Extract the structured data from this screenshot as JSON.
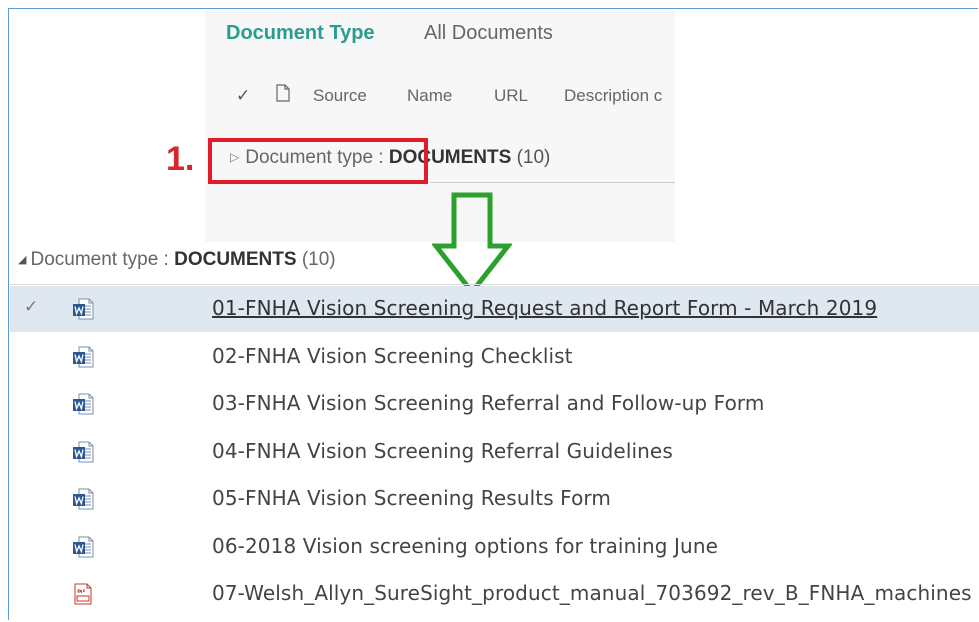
{
  "tabs": {
    "document_type": "Document Type",
    "all_documents": "All Documents"
  },
  "columns": {
    "check": "✓",
    "source": "Source",
    "name": "Name",
    "url": "URL",
    "description": "Description c"
  },
  "annotation": {
    "step": "1."
  },
  "group_top": {
    "label": "Document type :",
    "value": "DOCUMENTS",
    "count": "(10)"
  },
  "group_main": {
    "label": "Document type :",
    "value": "DOCUMENTS",
    "count": "(10)"
  },
  "documents": [
    {
      "name": "01-FNHA Vision Screening Request and Report Form - March 2019",
      "type": "word",
      "selected": true,
      "check": "✓"
    },
    {
      "name": "02-FNHA Vision Screening Checklist",
      "type": "word"
    },
    {
      "name": "03-FNHA Vision Screening Referral and Follow-up Form",
      "type": "word"
    },
    {
      "name": "04-FNHA Vision Screening Referral Guidelines",
      "type": "word"
    },
    {
      "name": "05-FNHA Vision Screening Results Form",
      "type": "word"
    },
    {
      "name": "06-2018 Vision screening options for training June",
      "type": "word"
    },
    {
      "name": "07-Welsh_Allyn_SureSight_product_manual_703692_rev_B_FNHA_machines",
      "type": "pdf"
    }
  ],
  "colors": {
    "accent_tab": "#2a9d8f",
    "annotation_red": "#e21b2d",
    "arrow_green": "#2ca02c",
    "selected_row": "#dfe8f1"
  }
}
